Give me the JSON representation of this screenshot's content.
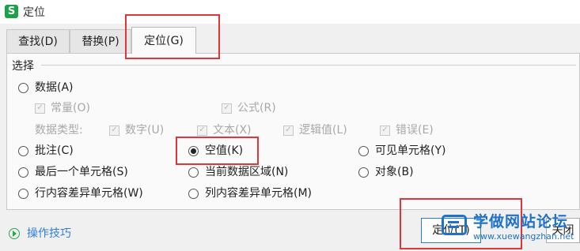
{
  "window": {
    "title": "定位",
    "app_icon": "S"
  },
  "tabs": [
    {
      "label": "查找(D)",
      "active": false
    },
    {
      "label": "替换(P)",
      "active": false
    },
    {
      "label": "定位(G)",
      "active": true
    }
  ],
  "section": {
    "label": "选择"
  },
  "data_option": {
    "label": "数据(A)",
    "selected": false,
    "sub_checks": [
      {
        "label": "常量(O)",
        "checked": true,
        "enabled": false
      },
      {
        "label": "公式(R)",
        "checked": true,
        "enabled": false
      }
    ],
    "type_label": "数据类型:",
    "type_checks": [
      {
        "label": "数字(U)",
        "checked": true,
        "enabled": false
      },
      {
        "label": "文本(X)",
        "checked": true,
        "enabled": false
      },
      {
        "label": "逻辑值(L)",
        "checked": true,
        "enabled": false
      },
      {
        "label": "错误(E)",
        "checked": true,
        "enabled": false
      }
    ]
  },
  "radios": [
    {
      "label": "批注(C)",
      "selected": false
    },
    {
      "label": "空值(K)",
      "selected": true
    },
    {
      "label": "可见单元格(Y)",
      "selected": false
    },
    {
      "label": "最后一个单元格(S)",
      "selected": false
    },
    {
      "label": "当前数据区域(N)",
      "selected": false
    },
    {
      "label": "对象(B)",
      "selected": false
    },
    {
      "label": "行内容差异单元格(W)",
      "selected": false
    },
    {
      "label": "列内容差异单元格(M)",
      "selected": false
    }
  ],
  "footer": {
    "tips_label": "操作技巧",
    "locate_button": "定位(T)",
    "close_button": "关闭"
  },
  "watermark": {
    "title": "学做网站论坛",
    "url": "www.xuewangzhan.net"
  },
  "colors": {
    "highlight": "#e0353b",
    "link": "#2f7fd6",
    "app_icon_bg": "#1aa14a",
    "watermark": "#1e72c9"
  }
}
